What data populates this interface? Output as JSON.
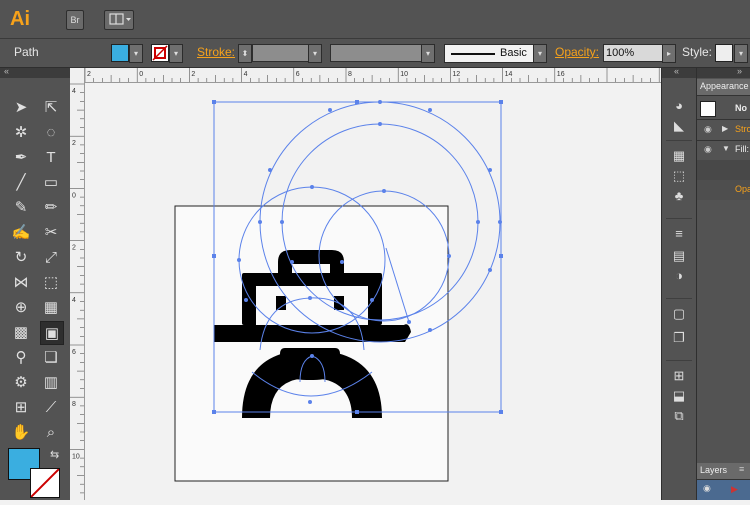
{
  "app": {
    "logo_text": "Ai",
    "bridge_label": "Br"
  },
  "controlbar": {
    "selection_label": "Path",
    "fill_color": "#3aaee0",
    "stroke_label": "Stroke:",
    "brush_label": "Basic",
    "opacity_label": "Opacity:",
    "opacity_value": "100%",
    "style_label": "Style:"
  },
  "rulers": {
    "top_ticks": [
      "2",
      "0",
      "2",
      "4",
      "6",
      "8",
      "10",
      "12",
      "14",
      "16"
    ],
    "left_ticks": [
      "4",
      "2",
      "0",
      "2",
      "4",
      "6",
      "8",
      "10"
    ]
  },
  "tools": {
    "fill_swatch_color": "#3aaee0"
  },
  "appearance_panel": {
    "tab_label": "Appearance",
    "no_selection": "No",
    "stroke_row": "Stro",
    "fill_row": "Fill:",
    "opacity_row": "Opa"
  },
  "layers_panel": {
    "tab_label": "Layers"
  }
}
